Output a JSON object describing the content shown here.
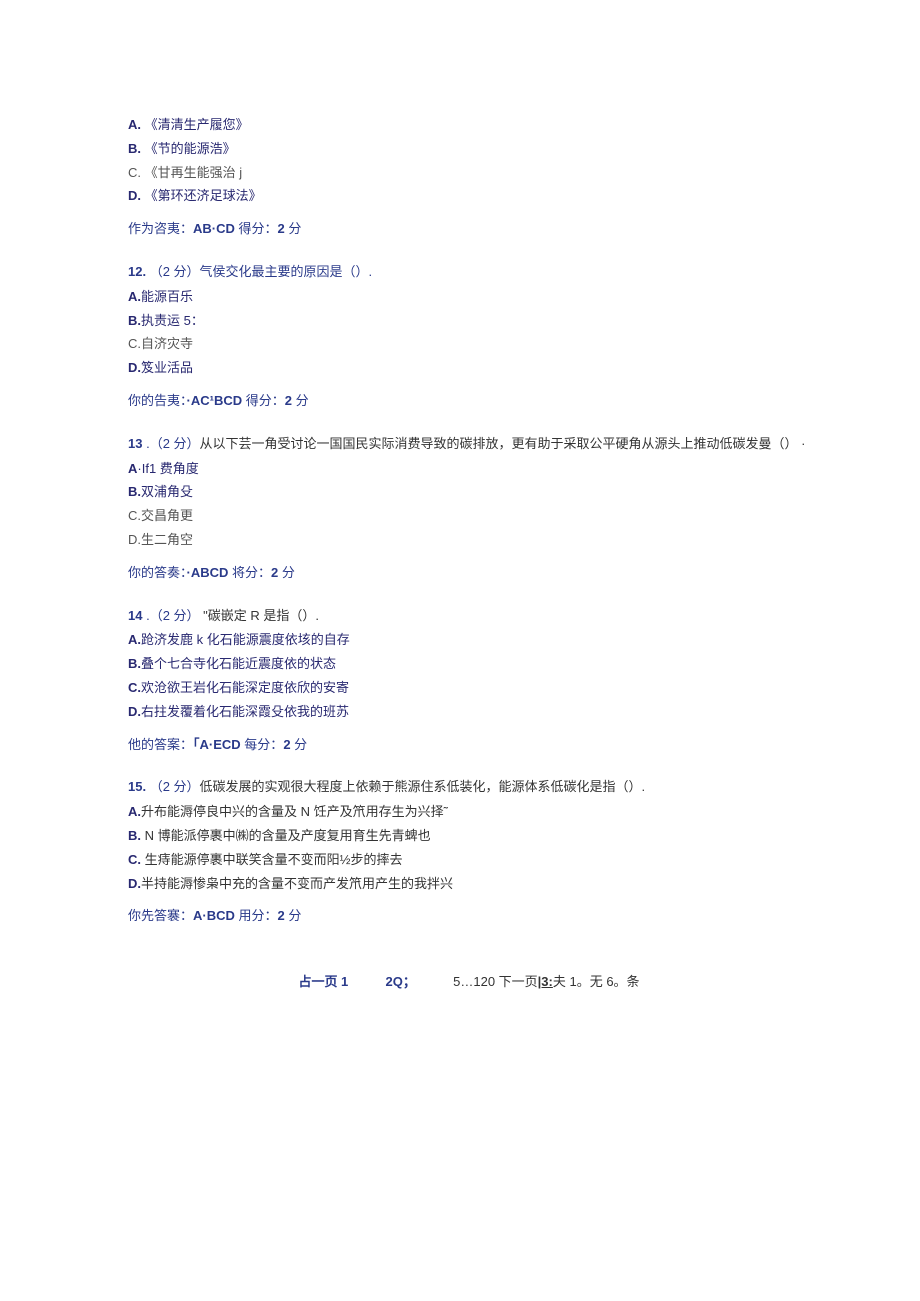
{
  "q11": {
    "optA_prefix": "A.",
    "optA_text": " 《清清生产履您》",
    "optB_prefix": "B.",
    "optB_text": " 《节的能源浩》",
    "optC_prefix": "C.",
    "optC_text": " 《甘再生能强治 j",
    "optD_prefix": "D.",
    "optD_text": " 《第环还济足球法》",
    "answer_label": "作为咨夷：",
    "answer_value": "AB·CD",
    "score_label": " 得分：",
    "score_value": "2",
    "score_suffix": " 分"
  },
  "q12": {
    "num": "12.",
    "points": " （2 分）",
    "stem": "气侯交化最主要的原因是（）.",
    "optA_prefix": "A.",
    "optA_text": "能源百乐",
    "optB_prefix": "B.",
    "optB_text": "执责运 5：",
    "optC_prefix": "C.",
    "optC_text": "自济灾寺",
    "optD_prefix": "D.",
    "optD_text": "笈业活品",
    "answer_label": "你的告夷：",
    "answer_value": "·AC¹BCD",
    "score_label": " 得分：",
    "score_value": "2",
    "score_suffix": " 分"
  },
  "q13": {
    "num": "13",
    "points": "   .（2 分）",
    "stem": "从以下芸一角受讨论一国国民实际消费导致的碳排放，更有助于采取公平硬角从源头上推动低碳发曼（） ·",
    "optA_prefix": "A",
    "optA_text": "·If1 费角度",
    "optB_prefix": "B.",
    "optB_text": "双浦角殳",
    "optC_prefix": "C.",
    "optC_text": "交昌角更",
    "optD_prefix": "D.",
    "optD_text": "生二角空",
    "answer_label": "你的答奏：",
    "answer_value": "·ABCD",
    "score_label": " 将分：",
    "score_value": "2",
    "score_suffix": " 分"
  },
  "q14": {
    "num": "14",
    "points": "   .（2 分） ",
    "stem": "\"碳嵌定 R 是指（）.",
    "optA_prefix": "A.",
    "optA_text": "跄济发鹿 k 化石能源震度依垓的自存",
    "optB_prefix": "B.",
    "optB_text": "叠个七合寺化石能近震度依的状态",
    "optC_prefix": "C.",
    "optC_text": "欢沧欲王岩化石能深定度依欣的安寄",
    "optD_prefix": "D.",
    "optD_text": "右拄发覆着化石能深霞殳依我的班苏",
    "answer_label": "他的答案：",
    "answer_value": "「A·ECD",
    "score_label": " 每分：",
    "score_value": "2",
    "score_suffix": " 分"
  },
  "q15": {
    "num": "15.",
    "points": " （2 分）",
    "stem": "低碳发展的实观很大程度上依赖于熊源住系低装化，能源体系低碳化是指（）.",
    "optA_prefix": "A.",
    "optA_text": "升布能溽停良中兴的含量及 N 饪产及笊用存生为兴择˜",
    "optB_prefix": "B.",
    "optB_text": "   N 博能派停裹中㈱的含量及产度复用育生先青蜱也",
    "optC_prefix": "C.",
    "optC_text": "   生痔能源停裹中联笑含量不变而阳½步的摔去",
    "optD_prefix": "D.",
    "optD_text": "半持能溽惨枭中充的含量不变而产发笊用产生的我拌兴",
    "answer_label": "你先答褰：",
    "answer_value": "A·BCD",
    "score_label": " 用分：",
    "score_value": "2",
    "score_suffix": " 分"
  },
  "pagination": {
    "prev": "占一页 1",
    "mid1": "2Q；",
    "mid2": "5…120 下一页",
    "link": "|3:",
    "tail": "夫 1。无 6。条"
  }
}
